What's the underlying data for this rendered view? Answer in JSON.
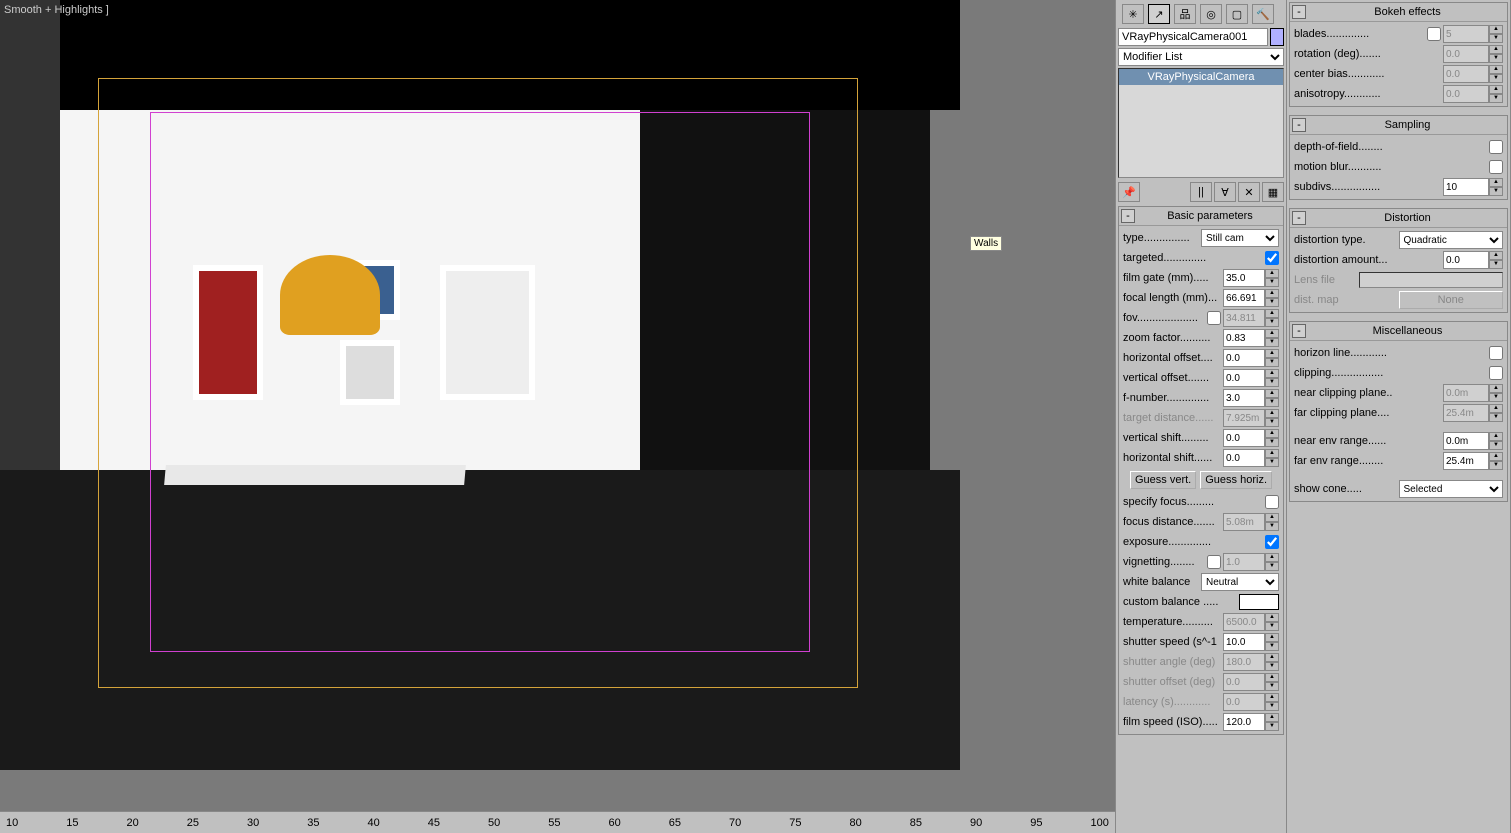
{
  "viewport": {
    "shading_label": "Smooth + Highlights ]",
    "tooltip": "Walls",
    "ruler_ticks": [
      "10",
      "15",
      "20",
      "25",
      "30",
      "35",
      "40",
      "45",
      "50",
      "55",
      "60",
      "65",
      "70",
      "75",
      "80",
      "85",
      "90",
      "95",
      "100"
    ]
  },
  "modifier_panel": {
    "object_name": "VRayPhysicalCamera001",
    "modifier_list_label": "Modifier List",
    "stack_item": "VRayPhysicalCamera",
    "basic_params": {
      "title": "Basic parameters",
      "type_label": "type...............",
      "type_value": "Still cam",
      "targeted_label": "targeted..............",
      "targeted_checked": true,
      "film_gate_label": "film gate (mm).....",
      "film_gate_value": "35.0",
      "focal_length_label": "focal length (mm)...",
      "focal_length_value": "66.691",
      "fov_label": "fov....................",
      "fov_checked": false,
      "fov_value": "34.811",
      "zoom_label": "zoom factor..........",
      "zoom_value": "0.83",
      "hoff_label": "horizontal offset....",
      "hoff_value": "0.0",
      "voff_label": "vertical offset.......",
      "voff_value": "0.0",
      "fnumber_label": "f-number..............",
      "fnumber_value": "3.0",
      "tdist_label": "target distance......",
      "tdist_value": "7.925m",
      "vshift_label": "vertical shift.........",
      "vshift_value": "0.0",
      "hshift_label": "horizontal shift......",
      "hshift_value": "0.0",
      "guess_vert": "Guess vert.",
      "guess_horiz": "Guess horiz.",
      "spec_focus_label": "specify focus.........",
      "spec_focus_checked": false,
      "focus_dist_label": "focus distance.......",
      "focus_dist_value": "5.08m",
      "exposure_label": "exposure..............",
      "exposure_checked": true,
      "vignetting_label": "vignetting........",
      "vignetting_checked": false,
      "vignetting_value": "1.0",
      "wb_label": "white balance",
      "wb_value": "Neutral",
      "custom_bal_label": "custom balance .....",
      "temp_label": "temperature..........",
      "temp_value": "6500.0",
      "shutter_speed_label": "shutter speed (s^-1",
      "shutter_speed_value": "10.0",
      "shutter_angle_label": "shutter angle (deg)",
      "shutter_angle_value": "180.0",
      "shutter_offset_label": "shutter offset (deg)",
      "shutter_offset_value": "0.0",
      "latency_label": "latency (s)............",
      "latency_value": "0.0",
      "iso_label": "film speed (ISO).....",
      "iso_value": "120.0"
    }
  },
  "bokeh": {
    "title": "Bokeh effects",
    "blades_label": "blades..............",
    "blades_checked": false,
    "blades_value": "5",
    "rotation_label": "rotation (deg).......",
    "rotation_value": "0.0",
    "center_bias_label": "center bias............",
    "center_bias_value": "0.0",
    "anisotropy_label": "anisotropy............",
    "anisotropy_value": "0.0"
  },
  "sampling": {
    "title": "Sampling",
    "dof_label": "depth-of-field........",
    "dof_checked": false,
    "motion_blur_label": "motion blur...........",
    "motion_blur_checked": false,
    "subdivs_label": "subdivs................",
    "subdivs_value": "10"
  },
  "distortion": {
    "title": "Distortion",
    "type_label": "distortion type.",
    "type_value": "Quadratic",
    "amount_label": "distortion amount...",
    "amount_value": "0.0",
    "lens_file_label": "Lens file",
    "dist_map_label": "dist. map",
    "dist_map_btn": "None"
  },
  "misc": {
    "title": "Miscellaneous",
    "horizon_label": "horizon line............",
    "horizon_checked": false,
    "clipping_label": "clipping.................",
    "clipping_checked": false,
    "near_clip_label": "near clipping plane..",
    "near_clip_value": "0.0m",
    "far_clip_label": "far clipping plane....",
    "far_clip_value": "25.4m",
    "near_env_label": "near env range......",
    "near_env_value": "0.0m",
    "far_env_label": "far env range........",
    "far_env_value": "25.4m",
    "show_cone_label": "show cone.....",
    "show_cone_value": "Selected"
  }
}
